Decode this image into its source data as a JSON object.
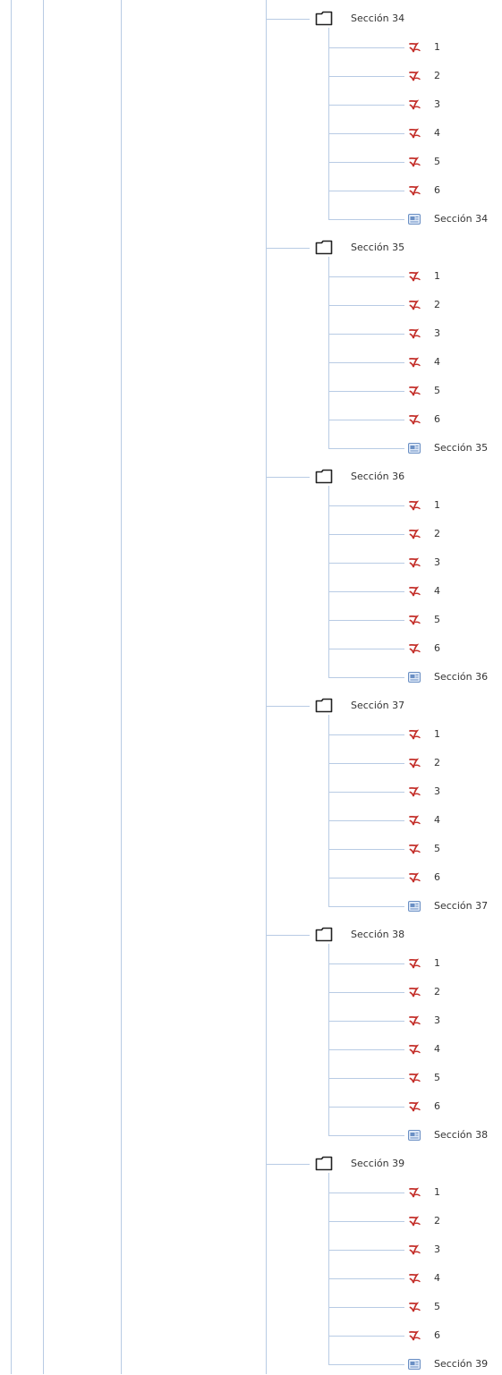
{
  "tree": {
    "sections": [
      {
        "folder_label": "Sección 34",
        "files": [
          {
            "label": "1",
            "icon": "pdf-icon"
          },
          {
            "label": "2",
            "icon": "pdf-icon"
          },
          {
            "label": "3",
            "icon": "pdf-icon"
          },
          {
            "label": "4",
            "icon": "pdf-icon"
          },
          {
            "label": "5",
            "icon": "pdf-icon"
          },
          {
            "label": "6",
            "icon": "pdf-icon"
          },
          {
            "label": "Sección 34",
            "icon": "document-icon"
          }
        ]
      },
      {
        "folder_label": "Sección 35",
        "files": [
          {
            "label": "1",
            "icon": "pdf-icon"
          },
          {
            "label": "2",
            "icon": "pdf-icon"
          },
          {
            "label": "3",
            "icon": "pdf-icon"
          },
          {
            "label": "4",
            "icon": "pdf-icon"
          },
          {
            "label": "5",
            "icon": "pdf-icon"
          },
          {
            "label": "6",
            "icon": "pdf-icon"
          },
          {
            "label": "Sección 35",
            "icon": "document-icon"
          }
        ]
      },
      {
        "folder_label": "Sección 36",
        "files": [
          {
            "label": "1",
            "icon": "pdf-icon"
          },
          {
            "label": "2",
            "icon": "pdf-icon"
          },
          {
            "label": "3",
            "icon": "pdf-icon"
          },
          {
            "label": "4",
            "icon": "pdf-icon"
          },
          {
            "label": "5",
            "icon": "pdf-icon"
          },
          {
            "label": "6",
            "icon": "pdf-icon"
          },
          {
            "label": "Sección 36",
            "icon": "document-icon"
          }
        ]
      },
      {
        "folder_label": "Sección 37",
        "files": [
          {
            "label": "1",
            "icon": "pdf-icon"
          },
          {
            "label": "2",
            "icon": "pdf-icon"
          },
          {
            "label": "3",
            "icon": "pdf-icon"
          },
          {
            "label": "4",
            "icon": "pdf-icon"
          },
          {
            "label": "5",
            "icon": "pdf-icon"
          },
          {
            "label": "6",
            "icon": "pdf-icon"
          },
          {
            "label": "Sección 37",
            "icon": "document-icon"
          }
        ]
      },
      {
        "folder_label": "Sección 38",
        "files": [
          {
            "label": "1",
            "icon": "pdf-icon"
          },
          {
            "label": "2",
            "icon": "pdf-icon"
          },
          {
            "label": "3",
            "icon": "pdf-icon"
          },
          {
            "label": "4",
            "icon": "pdf-icon"
          },
          {
            "label": "5",
            "icon": "pdf-icon"
          },
          {
            "label": "6",
            "icon": "pdf-icon"
          },
          {
            "label": "Sección 38",
            "icon": "document-icon"
          }
        ]
      },
      {
        "folder_label": "Sección 39",
        "files": [
          {
            "label": "1",
            "icon": "pdf-icon"
          },
          {
            "label": "2",
            "icon": "pdf-icon"
          },
          {
            "label": "3",
            "icon": "pdf-icon"
          },
          {
            "label": "4",
            "icon": "pdf-icon"
          },
          {
            "label": "5",
            "icon": "pdf-icon"
          },
          {
            "label": "6",
            "icon": "pdf-icon"
          },
          {
            "label": "Sección 39",
            "icon": "document-icon"
          }
        ]
      }
    ]
  },
  "colors": {
    "tree_line": "#b8cbe4",
    "pdf_icon": "#c4302b",
    "document_icon": "#6a8fc4",
    "folder_outline": "#222222",
    "text": "#333333"
  }
}
